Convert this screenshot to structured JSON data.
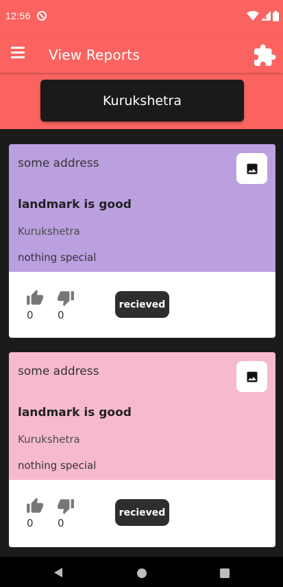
{
  "status_bar": {
    "time": "12:56"
  },
  "app_bar": {
    "title": "View Reports"
  },
  "header": {
    "city_button_label": "Kurukshetra"
  },
  "reports": [
    {
      "address": "some address",
      "landmark": "landmark is good",
      "city": "Kurukshetra",
      "note": "nothing special",
      "likes": "0",
      "dislikes": "0",
      "status": "recieved",
      "color": "#bba0e0"
    },
    {
      "address": "some address",
      "landmark": "landmark is good",
      "city": "Kurukshetra",
      "note": "nothing special",
      "likes": "0",
      "dislikes": "0",
      "status": "recieved",
      "color": "#f7bacd"
    }
  ],
  "colors": {
    "primary": "#fa6360",
    "dark": "#1b1b1b",
    "badge": "#2e2e2e"
  }
}
